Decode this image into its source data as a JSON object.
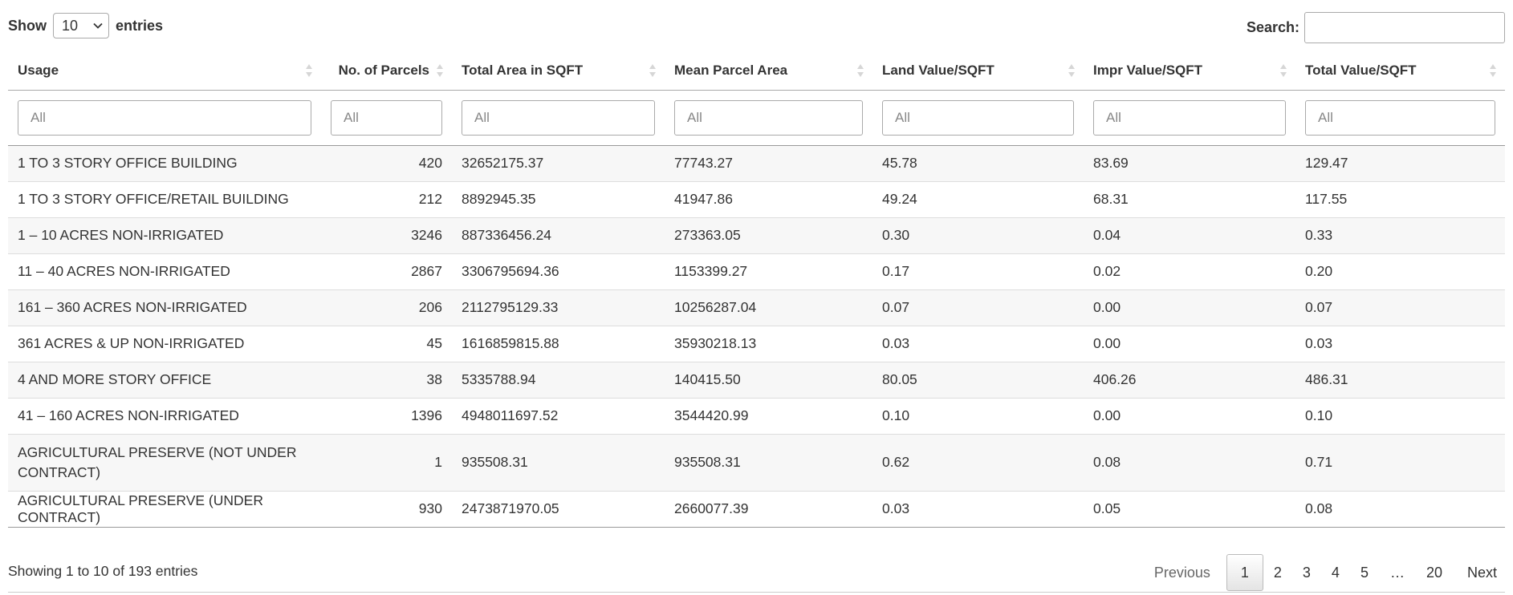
{
  "length": {
    "show_label": "Show",
    "value": "10",
    "entries_label": "entries"
  },
  "search": {
    "label": "Search:",
    "value": ""
  },
  "columns": [
    "Usage",
    "No. of Parcels",
    "Total Area in SQFT",
    "Mean Parcel Area",
    "Land Value/SQFT",
    "Impr Value/SQFT",
    "Total Value/SQFT"
  ],
  "filter_placeholder": "All",
  "rows": [
    [
      "1 TO 3 STORY OFFICE BUILDING",
      "420",
      "32652175.37",
      "77743.27",
      "45.78",
      "83.69",
      "129.47"
    ],
    [
      "1 TO 3 STORY OFFICE/RETAIL BUILDING",
      "212",
      "8892945.35",
      "41947.86",
      "49.24",
      "68.31",
      "117.55"
    ],
    [
      "1 – 10 ACRES NON-IRRIGATED",
      "3246",
      "887336456.24",
      "273363.05",
      "0.30",
      "0.04",
      "0.33"
    ],
    [
      "11 – 40 ACRES NON-IRRIGATED",
      "2867",
      "3306795694.36",
      "1153399.27",
      "0.17",
      "0.02",
      "0.20"
    ],
    [
      "161 – 360 ACRES NON-IRRIGATED",
      "206",
      "2112795129.33",
      "10256287.04",
      "0.07",
      "0.00",
      "0.07"
    ],
    [
      "361 ACRES & UP NON-IRRIGATED",
      "45",
      "1616859815.88",
      "35930218.13",
      "0.03",
      "0.00",
      "0.03"
    ],
    [
      "4 AND MORE STORY OFFICE",
      "38",
      "5335788.94",
      "140415.50",
      "80.05",
      "406.26",
      "486.31"
    ],
    [
      "41 – 160 ACRES NON-IRRIGATED",
      "1396",
      "4948011697.52",
      "3544420.99",
      "0.10",
      "0.00",
      "0.10"
    ],
    [
      "AGRICULTURAL PRESERVE (NOT UNDER CONTRACT)",
      "1",
      "935508.31",
      "935508.31",
      "0.62",
      "0.08",
      "0.71"
    ],
    [
      "AGRICULTURAL PRESERVE (UNDER CONTRACT)",
      "930",
      "2473871970.05",
      "2660077.39",
      "0.03",
      "0.05",
      "0.08"
    ]
  ],
  "info": "Showing 1 to 10 of 193 entries",
  "pagination": {
    "previous": "Previous",
    "pages": [
      "1",
      "2",
      "3",
      "4",
      "5"
    ],
    "ellipsis": "…",
    "last": "20",
    "next": "Next",
    "current": "1"
  },
  "icons": {
    "select": "chevron-down-icon",
    "sort": "sort-both-icon"
  }
}
